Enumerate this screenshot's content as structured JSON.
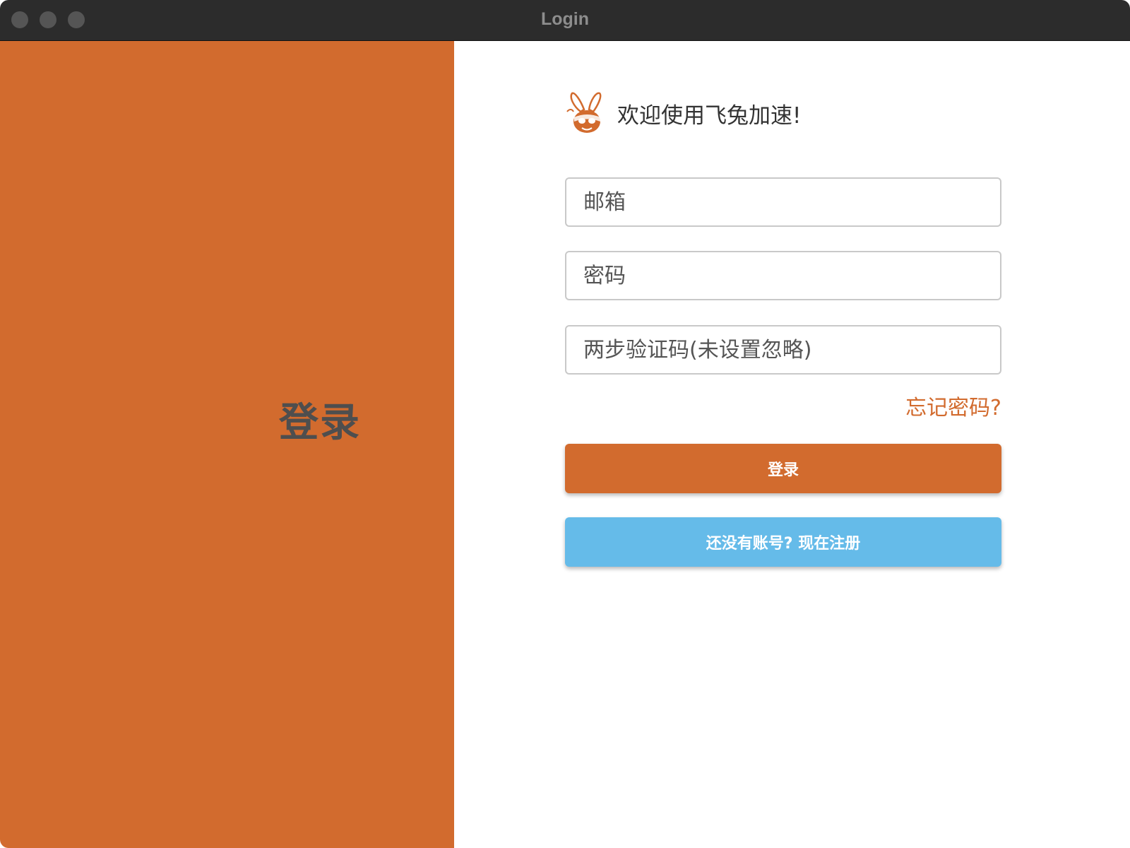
{
  "window": {
    "title": "Login"
  },
  "colors": {
    "accent": "#d26b2e",
    "secondary_button": "#65bbe9",
    "heading_text": "#4e4e4e"
  },
  "left_panel": {
    "heading": "登录"
  },
  "welcome": {
    "logo_icon": "rabbit-logo-icon",
    "text": "欢迎使用飞兔加速!"
  },
  "form": {
    "email_placeholder": "邮箱",
    "email_value": "",
    "password_placeholder": "密码",
    "password_value": "",
    "otp_placeholder": "两步验证码(未设置忽略)",
    "otp_value": "",
    "forgot_label": "忘记密码?",
    "login_label": "登录",
    "register_label": "还没有账号? 现在注册"
  }
}
